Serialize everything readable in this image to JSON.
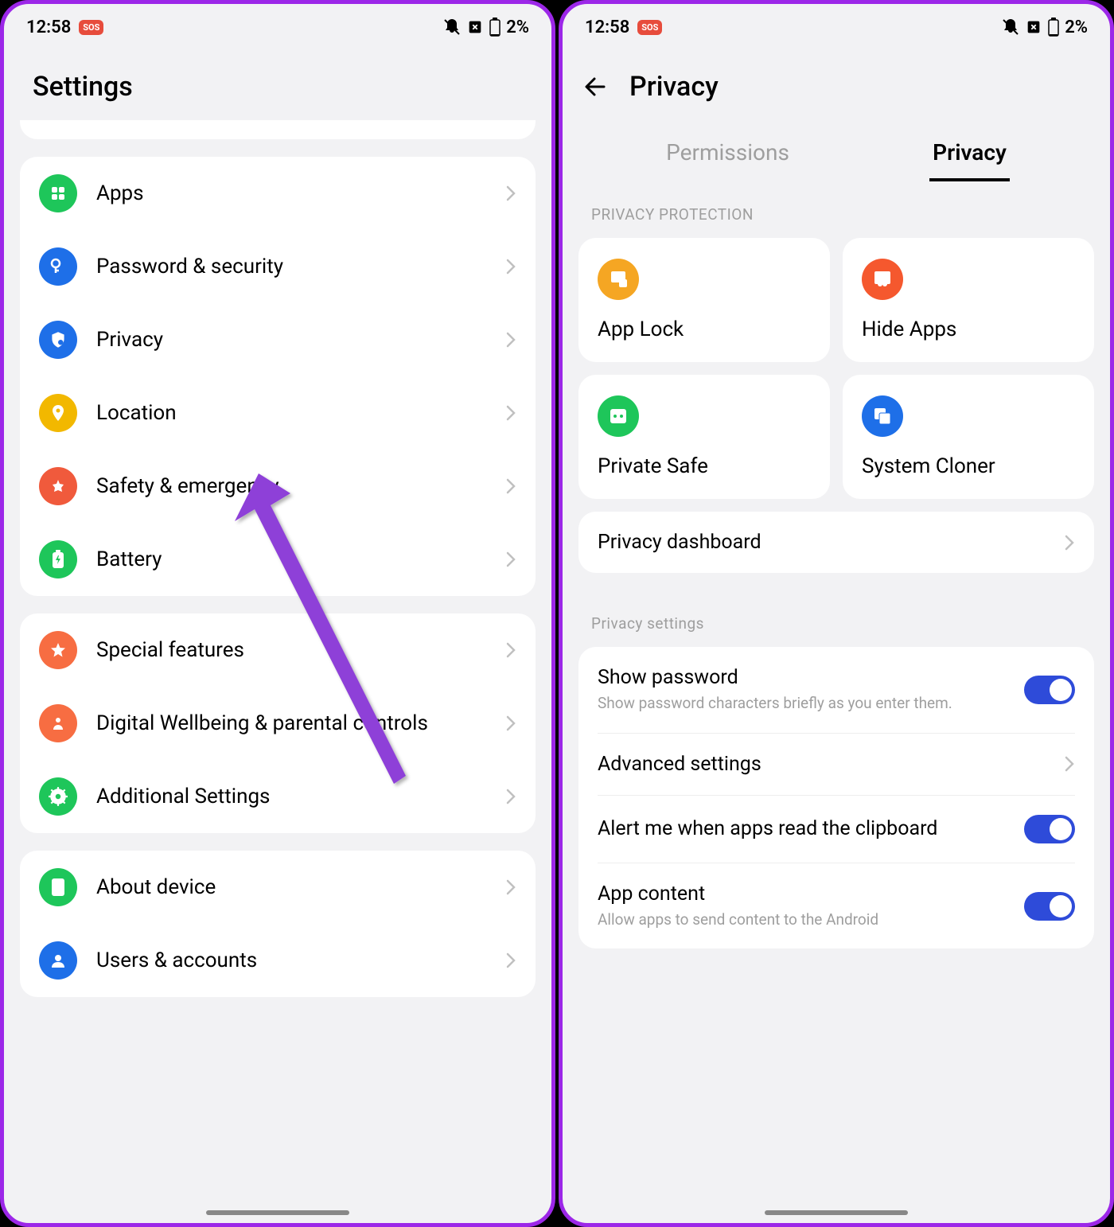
{
  "status": {
    "time": "12:58",
    "sos": "SOS",
    "battery": "2%"
  },
  "left": {
    "title": "Settings",
    "group1": [
      {
        "label": "Apps",
        "icon": "apps-icon",
        "color": "bg-green"
      },
      {
        "label": "Password & security",
        "icon": "key-icon",
        "color": "bg-blue"
      },
      {
        "label": "Privacy",
        "icon": "privacy-icon",
        "color": "bg-blue"
      },
      {
        "label": "Location",
        "icon": "location-icon",
        "color": "bg-yellow"
      },
      {
        "label": "Safety & emergency",
        "icon": "emergency-icon",
        "color": "bg-red"
      },
      {
        "label": "Battery",
        "icon": "battery-icon",
        "color": "bg-green"
      }
    ],
    "group2": [
      {
        "label": "Special features",
        "icon": "star-icon",
        "color": "bg-orange"
      },
      {
        "label": "Digital Wellbeing & parental controls",
        "icon": "heart-icon",
        "color": "bg-orange"
      },
      {
        "label": "Additional Settings",
        "icon": "gear-icon",
        "color": "bg-green"
      }
    ],
    "group3": [
      {
        "label": "About device",
        "icon": "device-icon",
        "color": "bg-green"
      },
      {
        "label": "Users & accounts",
        "icon": "user-icon",
        "color": "bg-blue"
      }
    ]
  },
  "right": {
    "title": "Privacy",
    "tabs": {
      "permissions": "Permissions",
      "privacy": "Privacy"
    },
    "section1": "PRIVACY PROTECTION",
    "tiles": [
      {
        "label": "App Lock",
        "icon": "lock-icon",
        "color": "bg-amber"
      },
      {
        "label": "Hide Apps",
        "icon": "hide-icon",
        "color": "bg-orange2"
      },
      {
        "label": "Private Safe",
        "icon": "safe-icon",
        "color": "bg-teal"
      },
      {
        "label": "System Cloner",
        "icon": "cloner-icon",
        "color": "bg-bluec"
      }
    ],
    "dashboard": "Privacy dashboard",
    "section2": "Privacy settings",
    "settings": {
      "show_password": {
        "title": "Show password",
        "subtitle": "Show password characters briefly as you enter them."
      },
      "advanced": {
        "title": "Advanced settings"
      },
      "clipboard": {
        "title": "Alert me when apps read the clipboard"
      },
      "app_content": {
        "title": "App content",
        "subtitle": "Allow apps to send content to the Android"
      }
    }
  }
}
